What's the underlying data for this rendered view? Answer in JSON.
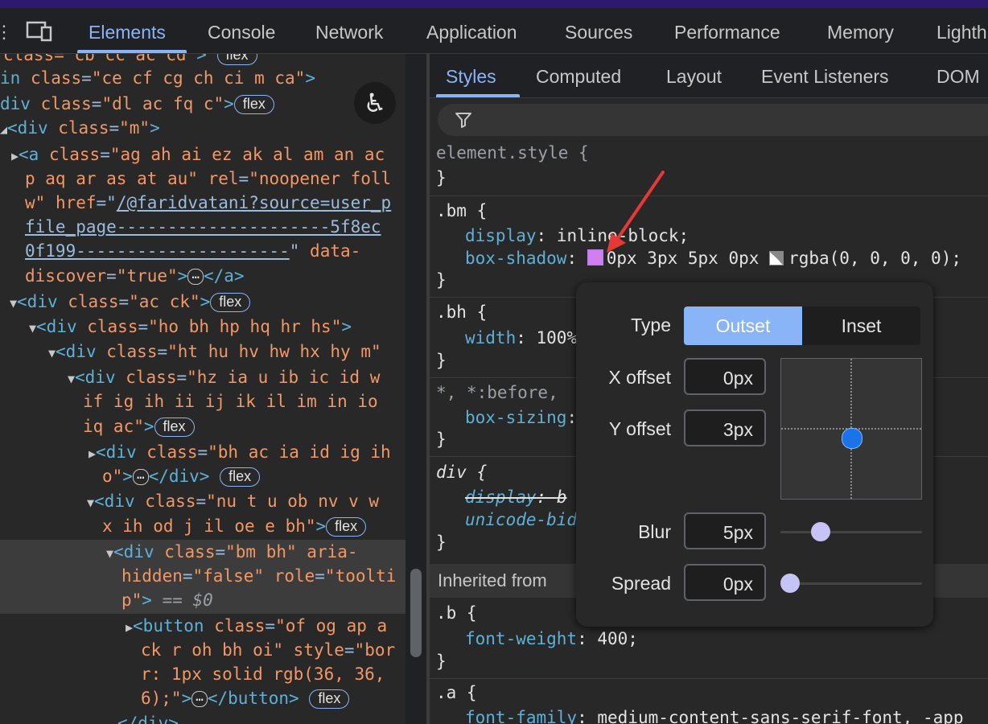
{
  "devtools_tabs": [
    "Elements",
    "Console",
    "Network",
    "Application",
    "Sources",
    "Performance",
    "Memory",
    "Lighth"
  ],
  "active_tab": "Elements",
  "styles_tabs": [
    "Styles",
    "Computed",
    "Layout",
    "Event Listeners",
    "DOM"
  ],
  "dom": {
    "l1_pre": "class=",
    "l1_val": "\"cb cc ac cd\"",
    "l1_post": ">",
    "l2_tag": "in ",
    "l2_an": "class",
    "l2_val": "\"ce cf cg ch ci m ca\"",
    "l3_tag": "div ",
    "l3_an": "class",
    "l3_val": "\"dl ac fq c\"",
    "l4_tag": "<div ",
    "l4_an": "class",
    "l4_val": "\"m\"",
    "l5_a": "<a ",
    "l5_an": "class",
    "l5_val": "\"ag ah ai ez ak al am an ac",
    "l6": "p aq ar as at au\"",
    "l6_an": "rel",
    "l6_val": "\"noopener foll",
    "l7_a": "w\"",
    "l7_an": "href",
    "l7_link": "/@faridvatani?source=user_p",
    "l8_link": "file_page---------------------5f8ec",
    "l9_link": "0f199---------------------",
    "l9_an": "data-",
    "l10_an": "discover",
    "l10_val": "\"true\"",
    "l10_close": "</a>",
    "l11_tag": "<div ",
    "l11_an": "class",
    "l11_val": "\"ac ck\"",
    "l12_an": "class",
    "l12_val": "\"ho bh hp hq hr hs\"",
    "l13_an": "class",
    "l13_val": "\"ht hu hv hw hx hy m\"",
    "l14_an": "class",
    "l14_val": "\"hz ia u ib ic id w",
    "l15": "if ig ih ii ij ik il im in io",
    "l16": "iq ac\"",
    "l17_an": "class",
    "l17_val": "\"bh ac ia id ig ih",
    "l18_val": "o\"",
    "l18_close": "</div>",
    "l19_an": "class",
    "l19_val": "\"nu t u ob nv v w",
    "l20": "x ih od j il oe e bh\"",
    "l21_an": "class",
    "l21_val": "\"bm bh\"",
    "l21_an2": "aria-",
    "l22_an": "hidden",
    "l22_val": "\"false\"",
    "l22_an2": "role",
    "l22_val2": "\"toolti",
    "l23_val": "p\"",
    "l23_eq": " == $0",
    "l24_tag": "<button ",
    "l24_an": "class",
    "l24_val": "\"of og ap a",
    "l25": "ck r oh bh oi\"",
    "l25_an": "style",
    "l25_val": "\"bor",
    "l26": "r: 1px solid rgb(36, 36,",
    "l27": "6);\"",
    "l27_close": "</button>",
    "l28": "</div>",
    "flex": "flex",
    "ellipsis": "…"
  },
  "styles": {
    "element_style": "element.style {",
    "bm_sel": ".bm {",
    "bm_p1": "display",
    "bm_v1": "inline-block;",
    "bm_p2": "box-shadow",
    "bm_v2a": "0px 3px 5px 0px",
    "bm_v2b": "rgba(0, 0, 0, 0);",
    "bh_sel": ".bh {",
    "bh_p1": "width",
    "bh_v1": "100%",
    "star_sel": "*, *:before, ",
    "star_p1": "box-sizing",
    "div_sel": "div {",
    "div_p1": "display",
    "div_v1": "b",
    "div_p2": "unicode-bid",
    "inherited": "Inherited from",
    "b_sel": ".b {",
    "b_p1": "font-weight",
    "b_v1": "400;",
    "a_sel": ".a {",
    "a_p1": "font-family",
    "a_v1": "medium-content-sans-serif-font, -app",
    "close": "}"
  },
  "shadow_editor": {
    "type_label": "Type",
    "outset": "Outset",
    "inset": "Inset",
    "x_label": "X offset",
    "x_value": "0px",
    "y_label": "Y offset",
    "y_value": "3px",
    "blur_label": "Blur",
    "blur_value": "5px",
    "spread_label": "Spread",
    "spread_value": "0px"
  }
}
